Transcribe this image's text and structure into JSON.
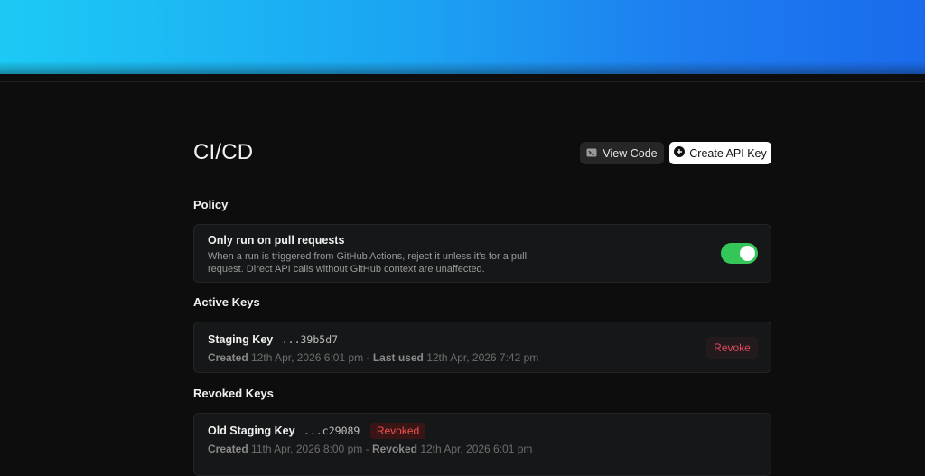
{
  "page": {
    "title": "CI/CD",
    "view_code_label": "View Code",
    "create_key_label": "Create API Key"
  },
  "policy": {
    "heading": "Policy",
    "title": "Only run on pull requests",
    "description": "When a run is triggered from GitHub Actions, reject it unless it's for a pull request. Direct API calls without GitHub context are unaffected.",
    "enabled": true
  },
  "active_keys": {
    "heading": "Active Keys",
    "items": [
      {
        "name": "Staging Key",
        "suffix": "...39b5d7",
        "created_label": "Created",
        "created": "12th Apr, 2026 6:01 pm",
        "separator": "-",
        "last_used_label": "Last used",
        "last_used": "12th Apr, 2026 7:42 pm",
        "action_label": "Revoke"
      }
    ]
  },
  "revoked_keys": {
    "heading": "Revoked Keys",
    "items": [
      {
        "name": "Old Staging Key",
        "suffix": "...c29089",
        "badge": "Revoked",
        "created_label": "Created",
        "created": "11th Apr, 2026 8:00 pm",
        "separator": "-",
        "revoked_label": "Revoked",
        "revoked": "12th Apr, 2026 6:01 pm"
      }
    ]
  },
  "colors": {
    "banner_start": "#1ccaf5",
    "banner_end": "#1a6bec",
    "toggle_on": "#35c65a",
    "danger": "#e0485f"
  }
}
